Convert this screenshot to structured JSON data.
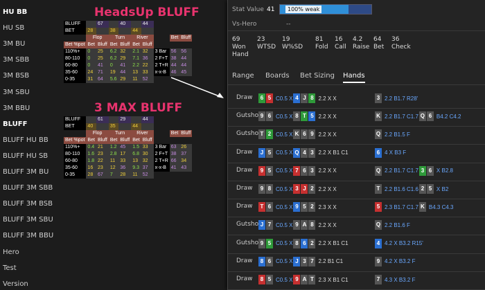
{
  "sidebar": {
    "items": [
      "HU BB",
      "HU SB",
      "3M BU",
      "3M SBB",
      "3M BSB",
      "3M SBU",
      "3M BBU",
      "BLUFF",
      "BLUFF HU BB",
      "BLUFF HU SB",
      "BLUFF 3M BU",
      "BLUFF 3M SBB",
      "BLUFF 3M BSB",
      "BLUFF 3M SBU",
      "BLUFF 3M BBU",
      "Hero",
      "Test",
      "Version"
    ],
    "active_index": 0
  },
  "title1": "HeadsUp  BLUFF",
  "title2": "3 MAX    BLUFF",
  "hu_table": {
    "bluff": [
      "BLUFF",
      "",
      "67",
      "",
      "40",
      "",
      "44"
    ],
    "bet": [
      "BET",
      "28",
      "",
      "38",
      "",
      "44",
      ""
    ],
    "streets": [
      "Flop",
      "Turn",
      "River"
    ],
    "head": [
      "Bet %pot",
      "Bet",
      "Bluff",
      "Bet",
      "Bluff",
      "Bet",
      "Bluff"
    ],
    "rows": [
      [
        "110%+",
        "0",
        "25",
        "6.2",
        "32",
        "2.1",
        "32"
      ],
      [
        "80-110",
        "0",
        "25",
        "6.2",
        "29",
        "7.1",
        "36"
      ],
      [
        "60-80",
        "0",
        "41",
        "0",
        "41",
        "2.2",
        "22"
      ],
      [
        "35-60",
        "24",
        "71",
        "19",
        "44",
        "13",
        "33"
      ],
      [
        "0-35",
        "31",
        "64",
        "5.6",
        "29",
        "11",
        "52"
      ]
    ],
    "side_head": [
      "Bet",
      "Bluff"
    ],
    "side": [
      [
        "3 Bar",
        "56",
        "56"
      ],
      [
        "2 F+T",
        "38",
        "44"
      ],
      [
        "2 T+R",
        "44",
        "44"
      ],
      [
        "x-x-B",
        "46",
        "45"
      ]
    ]
  },
  "max_table": {
    "bluff": [
      "BLUFF",
      "",
      "61",
      "",
      "29",
      "",
      "44"
    ],
    "bet": [
      "BET",
      "40",
      "",
      "35",
      "",
      "44",
      ""
    ],
    "streets": [
      "Flop",
      "Turn",
      "River"
    ],
    "head": [
      "Bet %pot",
      "Bet",
      "Bluff",
      "Bet",
      "Bluff",
      "Bet",
      "Bluff"
    ],
    "rows": [
      [
        "110%+",
        "0.4",
        "21",
        "1.2",
        "45",
        "1.5",
        "33"
      ],
      [
        "80-110",
        "1.6",
        "23",
        "2.8",
        "17",
        "6.8",
        "30"
      ],
      [
        "60-80",
        "1.8",
        "22",
        "11",
        "33",
        "13",
        "32"
      ],
      [
        "35-60",
        "16",
        "23",
        "12",
        "36",
        "9.3",
        "37"
      ],
      [
        "0-35",
        "28",
        "67",
        "7",
        "28",
        "11",
        "52"
      ]
    ],
    "side_head": [
      "Bet",
      "Bluff"
    ],
    "side": [
      [
        "3 Bar",
        "63",
        "26"
      ],
      [
        "2 F+T",
        "38",
        "37"
      ],
      [
        "2 T+R",
        "66",
        "34"
      ],
      [
        "x-x-B",
        "41",
        "43"
      ]
    ]
  },
  "popup": {
    "stat_label": "Stat Value",
    "stat_value": "41",
    "bar_fraction": 0.75,
    "bar_text": "100% weak",
    "vs_label": "Vs-Hero",
    "vs_value": "--",
    "stats": [
      {
        "value": "69",
        "label": "Won Hand"
      },
      {
        "value": "23",
        "label": "WTSD"
      },
      {
        "value": "19",
        "label": "W%SD"
      },
      {
        "value": "81",
        "label": "Fold"
      },
      {
        "value": "16",
        "label": "Call"
      },
      {
        "value": "4.2",
        "label": "Raise"
      },
      {
        "value": "64",
        "label": "Bet"
      },
      {
        "value": "36",
        "label": "Check"
      }
    ],
    "tabs": [
      "Range",
      "Boards",
      "Bet Sizing",
      "Hands"
    ],
    "active_tab": 3,
    "hands": [
      {
        "label": "Draw",
        "hole": [
          [
            "6",
            "g"
          ],
          [
            "5",
            "r"
          ]
        ],
        "act1": "C0.5 X",
        "board": [
          [
            "4",
            "b"
          ],
          [
            "J",
            "k"
          ],
          [
            "8",
            "g"
          ]
        ],
        "act2": "2.2 X X",
        "c1": [
          [
            "3",
            "k"
          ]
        ],
        "act3": "2.2 B1.7 R28'",
        "c2": [],
        "act4": ""
      },
      {
        "label": "Gutshot",
        "hole": [
          [
            "9",
            "k"
          ],
          [
            "6",
            "k"
          ]
        ],
        "act1": "C0.5 X",
        "board": [
          [
            "8",
            "k"
          ],
          [
            "T",
            "g"
          ],
          [
            "5",
            "b"
          ]
        ],
        "act2": "2.2 X X",
        "c1": [
          [
            "K",
            "k"
          ]
        ],
        "act3": "2.2 B1.7 C1.7",
        "c2": [
          [
            "Q",
            "k"
          ],
          [
            "6",
            "k"
          ]
        ],
        "act4": "B4.2 C4.2"
      },
      {
        "label": "Gutshot",
        "hole": [
          [
            "T",
            "k"
          ],
          [
            "2",
            "g"
          ]
        ],
        "act1": "C0.5 X",
        "board": [
          [
            "K",
            "k"
          ],
          [
            "6",
            "k"
          ],
          [
            "9",
            "k"
          ]
        ],
        "act2": "2.2 X X",
        "c1": [
          [
            "Q",
            "k"
          ]
        ],
        "act3": "2.2 B1.5 F",
        "c2": [],
        "act4": ""
      },
      {
        "label": "Draw",
        "hole": [
          [
            "J",
            "b"
          ],
          [
            "5",
            "k"
          ]
        ],
        "act1": "C0.5 X",
        "board": [
          [
            "Q",
            "b"
          ],
          [
            "4",
            "k"
          ],
          [
            "3",
            "k"
          ]
        ],
        "act2": "2.2 X B1 C1",
        "c1": [
          [
            "6",
            "b"
          ]
        ],
        "act3": "4 X B3 F",
        "c2": [],
        "act4": ""
      },
      {
        "label": "Draw",
        "hole": [
          [
            "9",
            "r"
          ],
          [
            "5",
            "k"
          ]
        ],
        "act1": "C0.5 X",
        "board": [
          [
            "7",
            "r"
          ],
          [
            "6",
            "k"
          ],
          [
            "3",
            "k"
          ]
        ],
        "act2": "2.2 X X",
        "c1": [
          [
            "Q",
            "k"
          ]
        ],
        "act3": "2.2 B1.7 C1.7",
        "c2": [
          [
            "3",
            "g"
          ],
          [
            "6",
            "k"
          ]
        ],
        "act4": "X B2.8"
      },
      {
        "label": "Draw",
        "hole": [
          [
            "9",
            "k"
          ],
          [
            "8",
            "k"
          ]
        ],
        "act1": "C0.5 X",
        "board": [
          [
            "3",
            "r"
          ],
          [
            "J",
            "r"
          ],
          [
            "2",
            "k"
          ]
        ],
        "act2": "2.2 X X",
        "c1": [
          [
            "T",
            "k"
          ]
        ],
        "act3": "2.2 B1.6 C1.6",
        "c2": [
          [
            "2",
            "k"
          ],
          [
            "5",
            "k"
          ]
        ],
        "act4": "X B2"
      },
      {
        "label": "Draw",
        "hole": [
          [
            "T",
            "r"
          ],
          [
            "6",
            "k"
          ]
        ],
        "act1": "C0.5 X",
        "board": [
          [
            "9",
            "b"
          ],
          [
            "5",
            "k"
          ],
          [
            "2",
            "k"
          ]
        ],
        "act2": "2.3 X X",
        "c1": [
          [
            "5",
            "r"
          ]
        ],
        "act3": "2.3 B1.7 C1.7",
        "c2": [
          [
            "K",
            "k"
          ]
        ],
        "act4": "B4.3 C4.3"
      },
      {
        "label": "Gutshot",
        "hole": [
          [
            "J",
            "b"
          ],
          [
            "7",
            "k"
          ]
        ],
        "act1": "C0.5 X",
        "board": [
          [
            "9",
            "k"
          ],
          [
            "A",
            "k"
          ],
          [
            "8",
            "k"
          ]
        ],
        "act2": "2.2 X X",
        "c1": [
          [
            "Q",
            "k"
          ]
        ],
        "act3": "2.2 B1.6 F",
        "c2": [],
        "act4": ""
      },
      {
        "label": "Gutshot",
        "hole": [
          [
            "9",
            "k"
          ],
          [
            "5",
            "g"
          ]
        ],
        "act1": "C0.5 X",
        "board": [
          [
            "8",
            "k"
          ],
          [
            "6",
            "b"
          ],
          [
            "2",
            "k"
          ]
        ],
        "act2": "2.2 X B1 C1",
        "c1": [
          [
            "4",
            "b"
          ]
        ],
        "act3": "4.2 X B3.2 R15'",
        "c2": [],
        "act4": ""
      },
      {
        "label": "Draw",
        "hole": [
          [
            "8",
            "b"
          ],
          [
            "6",
            "k"
          ]
        ],
        "act1": "C0.5 X",
        "board": [
          [
            "J",
            "b"
          ],
          [
            "3",
            "k"
          ],
          [
            "7",
            "k"
          ]
        ],
        "act2": "2.2 B1 C1",
        "c1": [
          [
            "9",
            "k"
          ]
        ],
        "act3": "4.2 X B3.2 F",
        "c2": [],
        "act4": ""
      },
      {
        "label": "Draw",
        "hole": [
          [
            "8",
            "r"
          ],
          [
            "5",
            "k"
          ]
        ],
        "act1": "C0.5 X",
        "board": [
          [
            "9",
            "r"
          ],
          [
            "A",
            "k"
          ],
          [
            "T",
            "k"
          ]
        ],
        "act2": "2.3 X B1 C1",
        "c1": [
          [
            "7",
            "k"
          ]
        ],
        "act3": "4.3 X B3.2 F",
        "c2": [],
        "act4": ""
      }
    ]
  }
}
